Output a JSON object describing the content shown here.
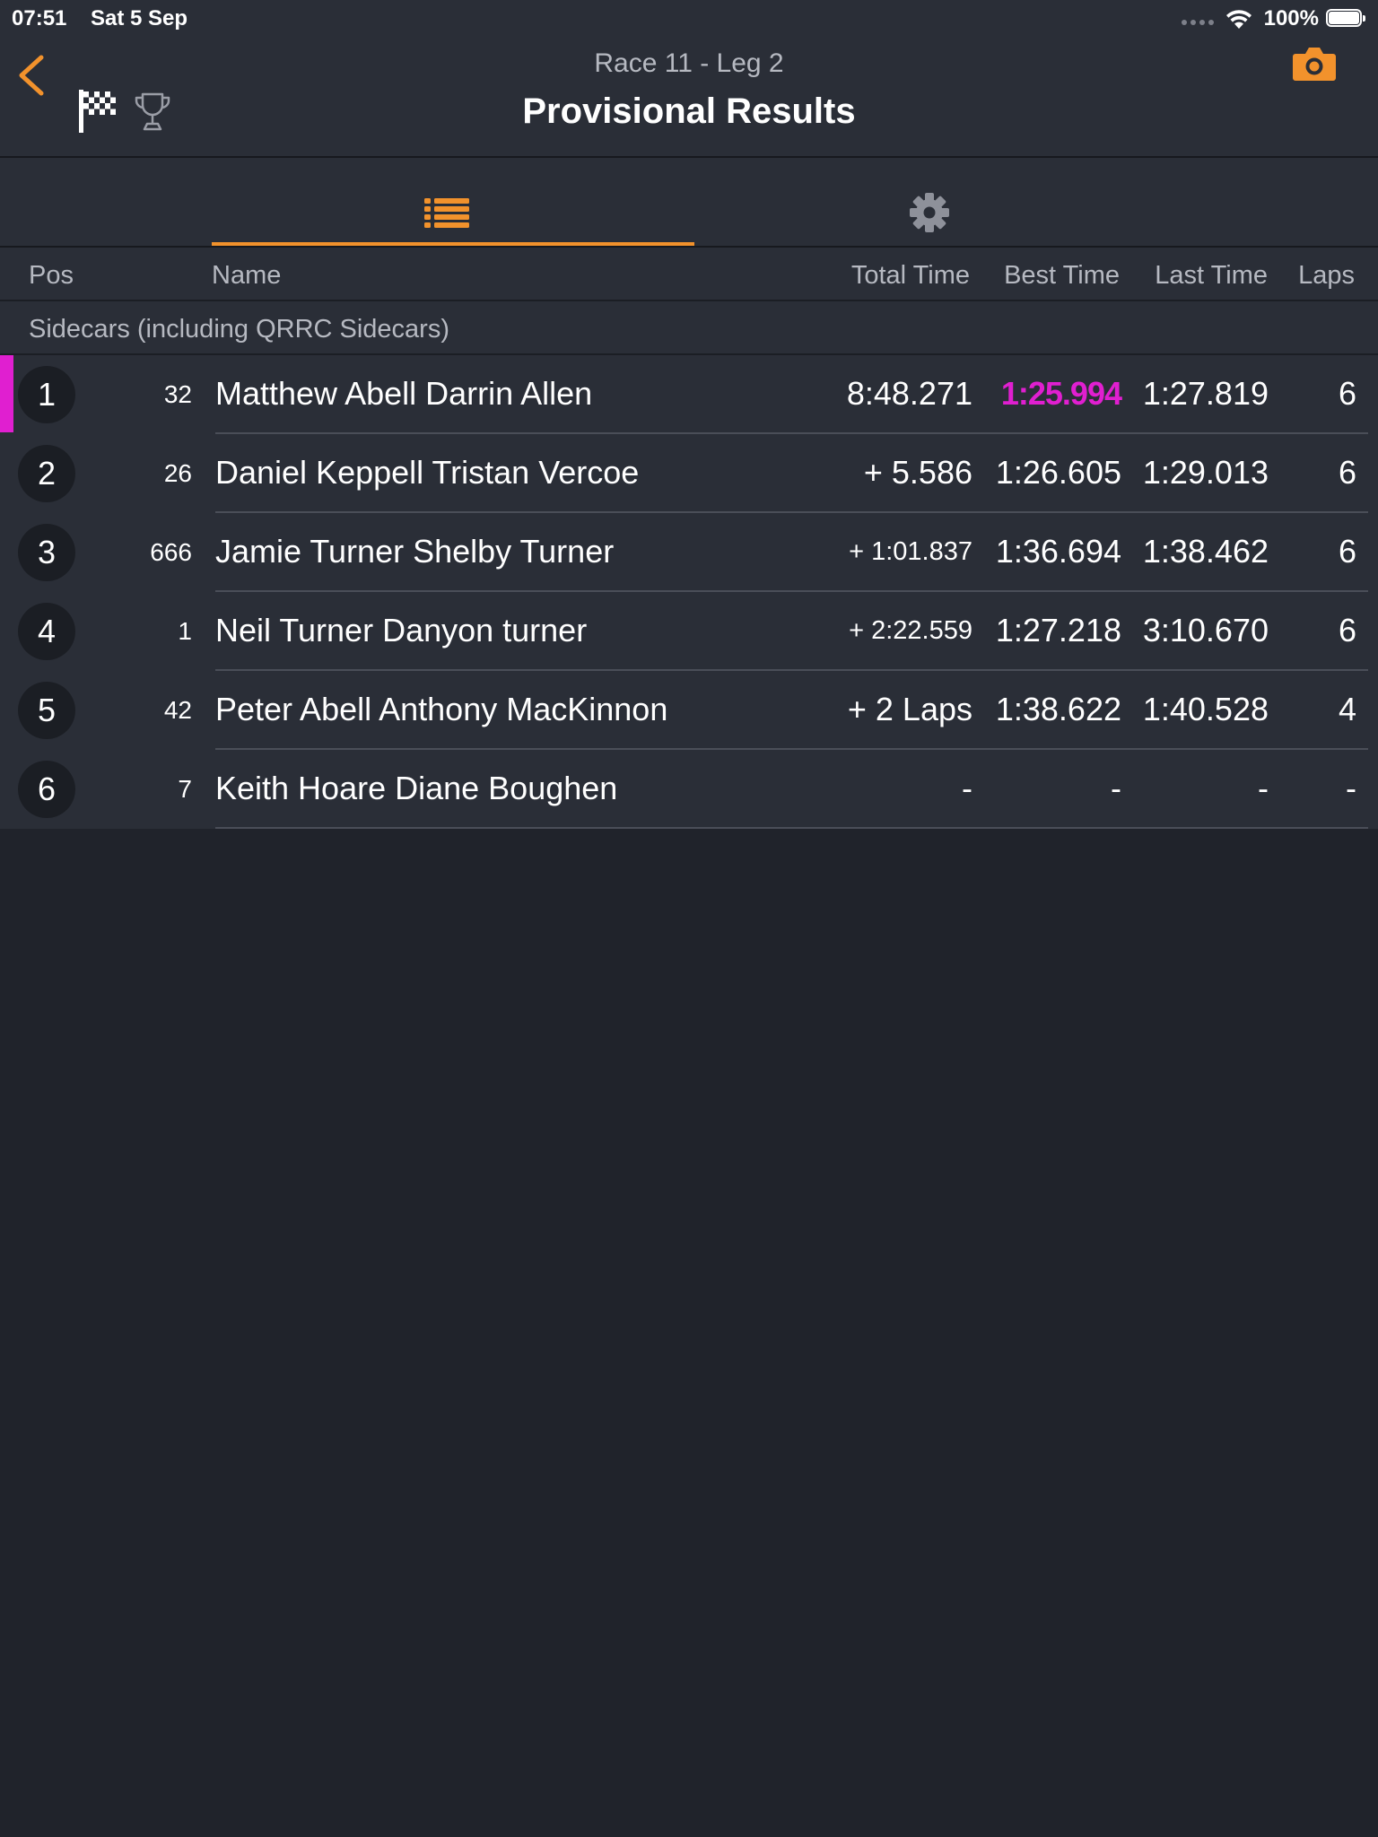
{
  "status_bar": {
    "time": "07:51",
    "date": "Sat 5 Sep",
    "battery": "100%"
  },
  "header": {
    "race": "Race 11 - Leg 2",
    "title": "Provisional Results",
    "icons": [
      "back-chevron-icon",
      "checkered-flag-icon",
      "trophy-icon",
      "camera-icon"
    ]
  },
  "tabs": [
    {
      "icon": "list-icon",
      "active": true
    },
    {
      "icon": "gear-icon",
      "active": false
    }
  ],
  "columns": {
    "pos": "Pos",
    "name": "Name",
    "total": "Total Time",
    "best": "Best Time",
    "last": "Last Time",
    "laps": "Laps"
  },
  "group": "Sidecars (including QRRC Sidecars)",
  "colors": {
    "accent": "#f2922c",
    "leader": "#e01fd0",
    "background": "#20232b",
    "panel": "#2a2e37"
  },
  "rows": [
    {
      "pos": "1",
      "num": "32",
      "name": "Matthew Abell Darrin Allen",
      "total": "8:48.271",
      "best": "1:25.994",
      "last": "1:27.819",
      "laps": "6"
    },
    {
      "pos": "2",
      "num": "26",
      "name": "Daniel Keppell Tristan Vercoe",
      "total": "+ 5.586",
      "best": "1:26.605",
      "last": "1:29.013",
      "laps": "6"
    },
    {
      "pos": "3",
      "num": "666",
      "name": "Jamie Turner Shelby Turner",
      "total": "+ 1:01.837",
      "best": "1:36.694",
      "last": "1:38.462",
      "laps": "6"
    },
    {
      "pos": "4",
      "num": "1",
      "name": "Neil Turner Danyon turner",
      "total": "+ 2:22.559",
      "best": "1:27.218",
      "last": "3:10.670",
      "laps": "6"
    },
    {
      "pos": "5",
      "num": "42",
      "name": "Peter Abell Anthony MacKinnon",
      "total": "+ 2 Laps",
      "best": "1:38.622",
      "last": "1:40.528",
      "laps": "4"
    },
    {
      "pos": "6",
      "num": "7",
      "name": "Keith Hoare Diane Boughen",
      "total": "-",
      "best": "-",
      "last": "-",
      "laps": "-"
    }
  ]
}
